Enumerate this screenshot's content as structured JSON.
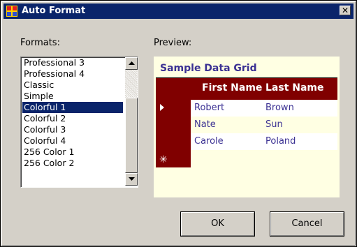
{
  "window": {
    "title": "Auto Format",
    "close_glyph": "✕",
    "icon": "app-grid-icon",
    "title_bar_color": "#0a246a"
  },
  "formats": {
    "label": "Formats:",
    "items": [
      "Professional 3",
      "Professional 4",
      "Classic",
      "Simple",
      "Colorful 1",
      "Colorful 2",
      "Colorful 3",
      "Colorful 4",
      "256 Color 1",
      "256 Color 2"
    ],
    "selected": "Colorful 1"
  },
  "preview": {
    "label": "Preview:",
    "caption": "Sample Data Grid",
    "columns": [
      "First Name",
      "Last Name"
    ],
    "rows": [
      [
        "Robert",
        "Brown"
      ],
      [
        "Nate",
        "Sun"
      ],
      [
        "Carole",
        "Poland"
      ]
    ],
    "new_row_glyph": "✳",
    "colors": {
      "background": "#ffffe3",
      "header": "#800000",
      "text": "#3b3193"
    }
  },
  "buttons": {
    "ok": "OK",
    "cancel": "Cancel"
  }
}
